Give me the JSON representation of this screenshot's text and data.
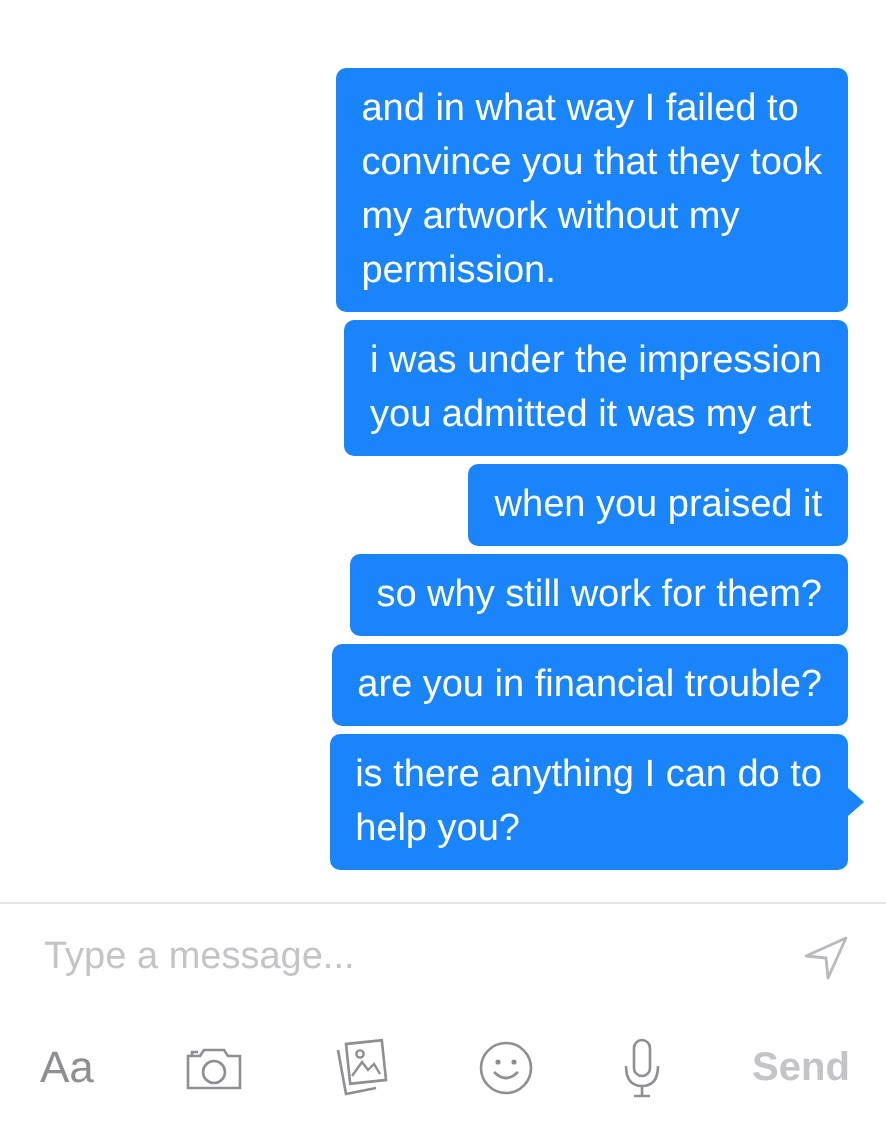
{
  "messages": [
    {
      "text": "and in what way I failed to\nconvince you that they took\nmy artwork without my\npermission.",
      "tail": false
    },
    {
      "text": "i was under the impression\nyou admitted it was my art",
      "tail": false
    },
    {
      "text": "when you praised it",
      "tail": false
    },
    {
      "text": "so why still work for them?",
      "tail": false
    },
    {
      "text": "are you in financial trouble?",
      "tail": false
    },
    {
      "text": "is there anything I can do to\nhelp you?",
      "tail": true
    }
  ],
  "composer": {
    "placeholder": "Type a message..."
  },
  "toolbar": {
    "font_label": "Aa",
    "send_label": "Send"
  }
}
